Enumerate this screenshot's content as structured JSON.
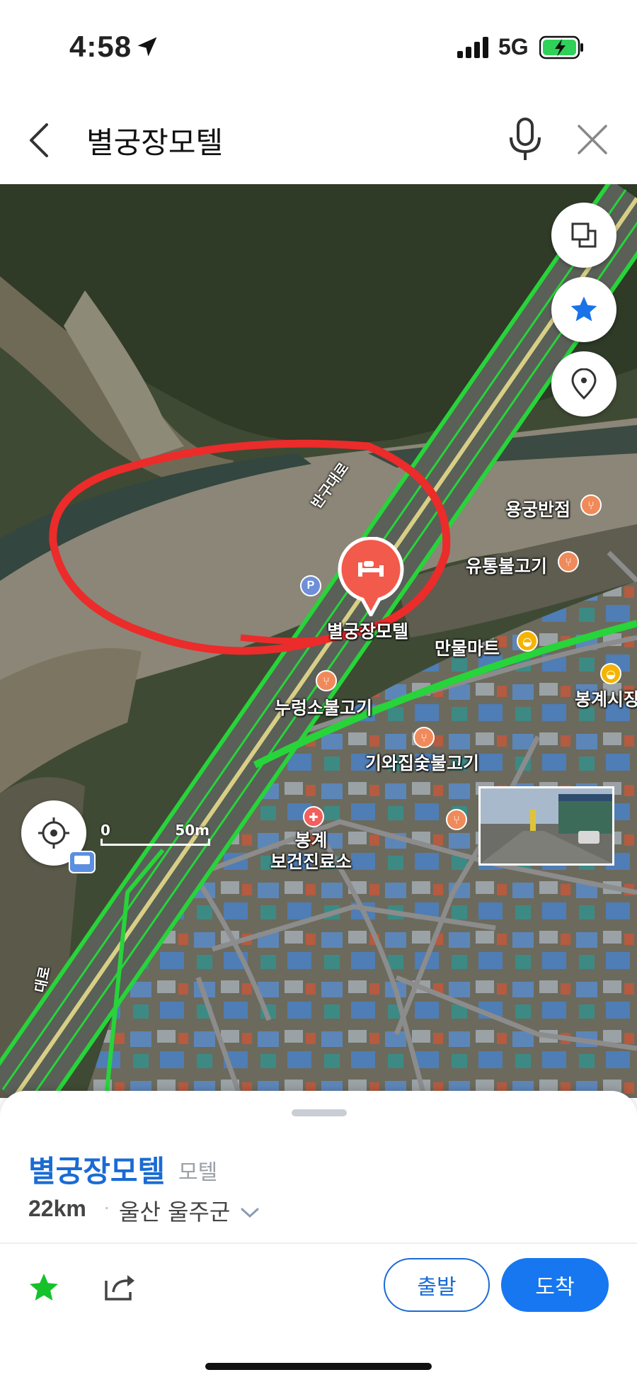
{
  "status_bar": {
    "time": "4:58",
    "network": "5G"
  },
  "header": {
    "title": "별궁장모텔"
  },
  "map": {
    "road_labels": [
      "반구대로",
      "대로"
    ],
    "pois": [
      {
        "name": "용궁반점",
        "type": "restaurant"
      },
      {
        "name": "유통불고기",
        "type": "restaurant"
      },
      {
        "name": "별궁장모텔",
        "type": "motel-selected"
      },
      {
        "name": "만물마트",
        "type": "shop"
      },
      {
        "name": "봉계시장",
        "type": "shop"
      },
      {
        "name": "누렁소불고기",
        "type": "restaurant"
      },
      {
        "name": "기와집숯불고기",
        "type": "restaurant"
      },
      {
        "name": "봉계\n보건진료소",
        "type": "medical"
      },
      {
        "name": "P",
        "type": "parking"
      }
    ],
    "scale": {
      "start": "0",
      "end": "50m"
    },
    "colors": {
      "route_green": "#27d43a",
      "annotation_red": "#ec2b2b",
      "marker_red": "#f25a4c"
    }
  },
  "sheet": {
    "place_name": "별궁장모텔",
    "category": "모텔",
    "distance": "22km",
    "separator": "·",
    "region": "울산 울주군",
    "depart_label": "출발",
    "arrive_label": "도착"
  },
  "colors": {
    "accent_blue": "#1677f0",
    "link_blue": "#1a6bd4",
    "star_green": "#16c22a"
  }
}
